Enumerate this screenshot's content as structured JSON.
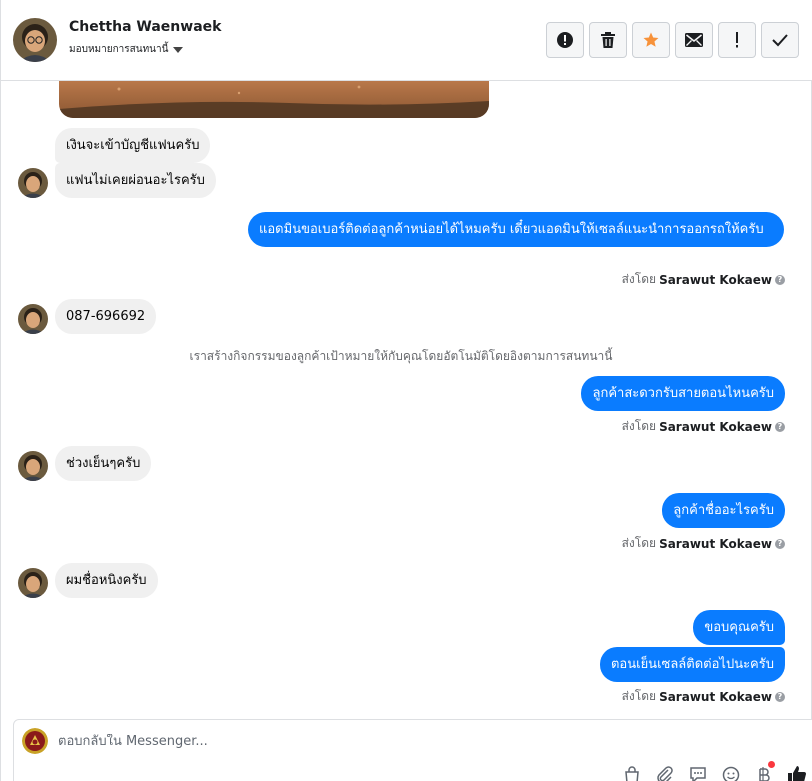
{
  "header": {
    "name": "Chettha Waenwaek",
    "assign_label": "มอบหมายการสนทนานี้"
  },
  "messages": [
    {
      "side": "in",
      "text": "เงินจะเข้าบัญชีแฟนครับ"
    },
    {
      "side": "in",
      "text": "แฟนไม่เคยผ่อนอะไรครับ"
    },
    {
      "side": "out",
      "text": "แอดมินขอเบอร์ติดต่อลูกค้าหน่อยได้ไหมครับ เดี๋ยวแอดมินให้เซลล์แนะนำการออกรถให้ครับ"
    },
    {
      "side": "in",
      "text": "087-696692"
    },
    {
      "side": "out",
      "text": "ลูกค้าสะดวกรับสายตอนไหนครับ"
    },
    {
      "side": "in",
      "text": "ช่วงเย็นๆครับ"
    },
    {
      "side": "out",
      "text": "ลูกค้าชื่ออะไรครับ"
    },
    {
      "side": "in",
      "text": "ผมชื่อหนิงครับ"
    },
    {
      "side": "out",
      "text": "ขอบคุณครับ"
    },
    {
      "side": "out",
      "text": "ตอนเย็นเซลล์ติดต่อไปนะครับ"
    }
  ],
  "sent_by": {
    "prefix": "ส่งโดย",
    "name": "Sarawut Kokaew"
  },
  "system_note": "เราสร้างกิจกรรมของลูกค้าเป้าหมายให้กับคุณโดยอัตโนมัติโดยอิงตามการสนทนานี้",
  "composer": {
    "placeholder": "ตอบกลับใน Messenger..."
  },
  "colors": {
    "outgoing": "#0a7cff",
    "incoming": "#f0f0f0",
    "star": "#f7923a",
    "like": "#1c1e21"
  },
  "icons": {
    "header_actions": [
      "alert-icon",
      "trash-icon",
      "star-icon",
      "mail-icon",
      "exclamation-icon",
      "check-icon"
    ],
    "composer_tools": [
      "bag-icon",
      "paperclip-icon",
      "speech-bubble-icon",
      "emoji-icon",
      "baht-icon",
      "like-icon"
    ]
  }
}
